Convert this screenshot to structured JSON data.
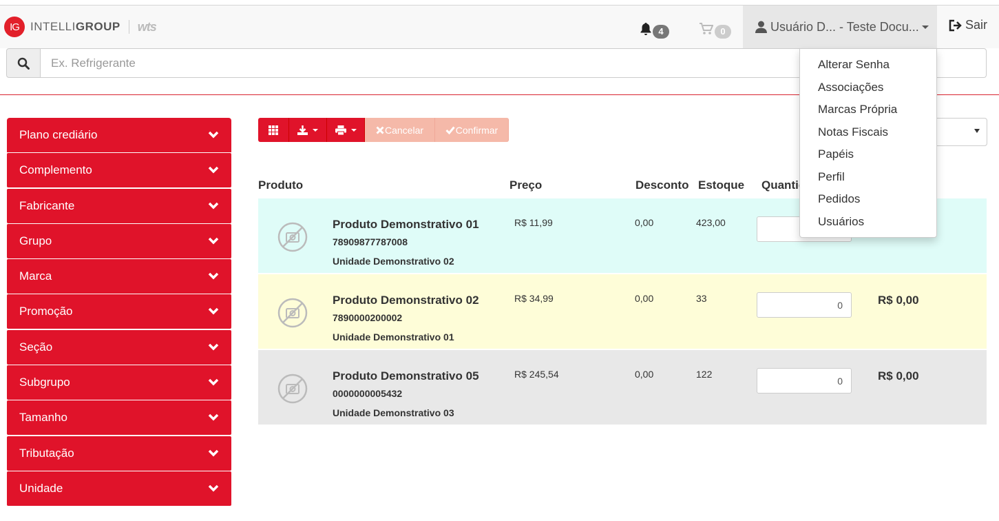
{
  "brand": {
    "logo_badge": "IG",
    "logo_text_light": "INTELLI",
    "logo_text_bold": "GROUP",
    "secondary_logo": "wts"
  },
  "navbar": {
    "notifications_count": "4",
    "cart_count": "0",
    "user_label": "Usuário D... - Teste Docu...",
    "exit_label": "Sair"
  },
  "search": {
    "placeholder": "Ex. Refrigerante"
  },
  "user_menu": [
    "Alterar Senha",
    "Associações",
    "Marcas Própria",
    "Notas Fiscais",
    "Papéis",
    "Perfil",
    "Pedidos",
    "Usuários"
  ],
  "sidebar": {
    "items": [
      "Plano crediário",
      "Complemento",
      "Fabricante",
      "Grupo",
      "Marca",
      "Promoção",
      "Seção",
      "Subgrupo",
      "Tamanho",
      "Tributação",
      "Unidade"
    ]
  },
  "toolbar": {
    "cancel_label": "Cancelar",
    "confirm_label": "Confirmar"
  },
  "table": {
    "headers": {
      "product": "Produto",
      "price": "Preço",
      "discount": "Desconto",
      "stock": "Estoque",
      "quantity": "Quantidade"
    },
    "rows": [
      {
        "name": "Produto Demonstrativo 01",
        "code": "78909877787008",
        "unit": "Unidade Demonstrativo 02",
        "price": "R$ 11,99",
        "discount": "0,00",
        "stock": "423,00",
        "quantity": "",
        "total": ""
      },
      {
        "name": "Produto Demonstrativo 02",
        "code": "7890000200002",
        "unit": "Unidade Demonstrativo 01",
        "price": "R$ 34,99",
        "discount": "0,00",
        "stock": "33",
        "quantity": "0",
        "total": "R$ 0,00"
      },
      {
        "name": "Produto Demonstrativo 05",
        "code": "0000000005432",
        "unit": "Unidade Demonstrativo 03",
        "price": "R$ 245,54",
        "discount": "0,00",
        "stock": "122",
        "quantity": "0",
        "total": "R$ 0,00"
      }
    ]
  },
  "colors": {
    "primary_red": "#e0132a",
    "disabled_button": "#f5b9a9",
    "row_cyan": "#dffcf8",
    "row_yellow": "#fefdd8",
    "row_gray": "#e8e8e8"
  },
  "icons": [
    "bell-icon",
    "cart-icon",
    "user-icon",
    "sign-out-icon",
    "search-icon",
    "chevron-down-icon",
    "grid-icon",
    "download-icon",
    "print-icon",
    "times-icon",
    "check-icon",
    "no-image-icon"
  ]
}
